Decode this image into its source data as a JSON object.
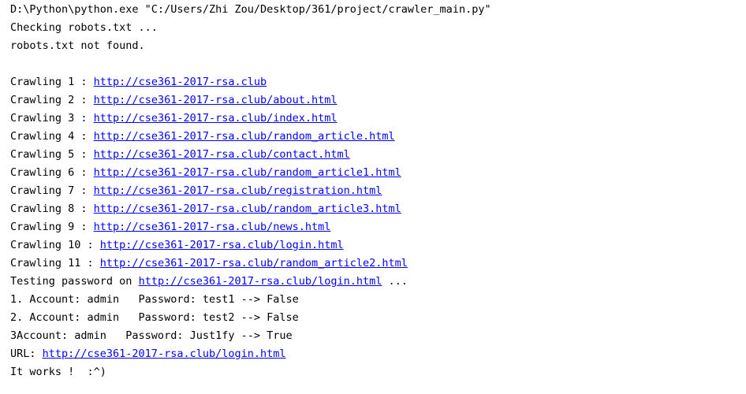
{
  "console": {
    "lines": [
      {
        "parts": [
          {
            "text": "D:\\Python\\python.exe \"C:/Users/Zhi Zou/Desktop/361/project/crawler_main.py\""
          }
        ]
      },
      {
        "parts": [
          {
            "text": "Checking robots.txt ..."
          }
        ]
      },
      {
        "parts": [
          {
            "text": "robots.txt not found."
          }
        ]
      },
      {
        "parts": []
      },
      {
        "parts": [
          {
            "text": "Crawling 1 : "
          },
          {
            "text": "http://cse361-2017-rsa.club",
            "link": true
          }
        ]
      },
      {
        "parts": [
          {
            "text": "Crawling 2 : "
          },
          {
            "text": "http://cse361-2017-rsa.club/about.html",
            "link": true
          }
        ]
      },
      {
        "parts": [
          {
            "text": "Crawling 3 : "
          },
          {
            "text": "http://cse361-2017-rsa.club/index.html",
            "link": true
          }
        ]
      },
      {
        "parts": [
          {
            "text": "Crawling 4 : "
          },
          {
            "text": "http://cse361-2017-rsa.club/random_article.html",
            "link": true
          }
        ]
      },
      {
        "parts": [
          {
            "text": "Crawling 5 : "
          },
          {
            "text": "http://cse361-2017-rsa.club/contact.html",
            "link": true
          }
        ]
      },
      {
        "parts": [
          {
            "text": "Crawling 6 : "
          },
          {
            "text": "http://cse361-2017-rsa.club/random_article1.html",
            "link": true
          }
        ]
      },
      {
        "parts": [
          {
            "text": "Crawling 7 : "
          },
          {
            "text": "http://cse361-2017-rsa.club/registration.html",
            "link": true
          }
        ]
      },
      {
        "parts": [
          {
            "text": "Crawling 8 : "
          },
          {
            "text": "http://cse361-2017-rsa.club/random_article3.html",
            "link": true
          }
        ]
      },
      {
        "parts": [
          {
            "text": "Crawling 9 : "
          },
          {
            "text": "http://cse361-2017-rsa.club/news.html",
            "link": true
          }
        ]
      },
      {
        "parts": [
          {
            "text": "Crawling 10 : "
          },
          {
            "text": "http://cse361-2017-rsa.club/login.html",
            "link": true
          }
        ]
      },
      {
        "parts": [
          {
            "text": "Crawling 11 : "
          },
          {
            "text": "http://cse361-2017-rsa.club/random_article2.html",
            "link": true
          }
        ]
      },
      {
        "parts": [
          {
            "text": "Testing password on "
          },
          {
            "text": "http://cse361-2017-rsa.club/login.html",
            "link": true
          },
          {
            "text": " ..."
          }
        ]
      },
      {
        "parts": [
          {
            "text": "1. Account: admin   Password: test1 --> False"
          }
        ]
      },
      {
        "parts": [
          {
            "text": "2. Account: admin   Password: test2 --> False"
          }
        ]
      },
      {
        "parts": [
          {
            "text": "3Account: admin   Password: Just1fy --> True"
          }
        ]
      },
      {
        "parts": [
          {
            "text": "URL: "
          },
          {
            "text": "http://cse361-2017-rsa.club/login.html",
            "link": true
          }
        ]
      },
      {
        "parts": [
          {
            "text": "It works !  :^)"
          }
        ]
      }
    ]
  }
}
